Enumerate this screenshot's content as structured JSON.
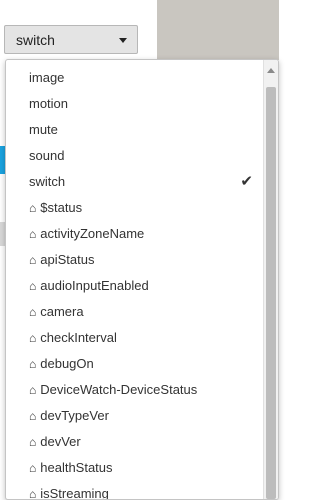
{
  "select": {
    "value": "switch"
  },
  "dropdown": {
    "selected": "switch",
    "options": [
      {
        "label": "image",
        "icon": "",
        "checked": false
      },
      {
        "label": "motion",
        "icon": "",
        "checked": false
      },
      {
        "label": "mute",
        "icon": "",
        "checked": false
      },
      {
        "label": "sound",
        "icon": "",
        "checked": false
      },
      {
        "label": "switch",
        "icon": "",
        "checked": true
      },
      {
        "label": "$status",
        "icon": "⌂",
        "checked": false
      },
      {
        "label": "activityZoneName",
        "icon": "⌂",
        "checked": false
      },
      {
        "label": "apiStatus",
        "icon": "⌂",
        "checked": false
      },
      {
        "label": "audioInputEnabled",
        "icon": "⌂",
        "checked": false
      },
      {
        "label": "camera",
        "icon": "⌂",
        "checked": false
      },
      {
        "label": "checkInterval",
        "icon": "⌂",
        "checked": false
      },
      {
        "label": "debugOn",
        "icon": "⌂",
        "checked": false
      },
      {
        "label": "DeviceWatch-DeviceStatus",
        "icon": "⌂",
        "checked": false
      },
      {
        "label": "devTypeVer",
        "icon": "⌂",
        "checked": false
      },
      {
        "label": "devVer",
        "icon": "⌂",
        "checked": false
      },
      {
        "label": "healthStatus",
        "icon": "⌂",
        "checked": false
      },
      {
        "label": "isStreaming",
        "icon": "⌂",
        "checked": false
      }
    ],
    "check_glyph": "✔"
  }
}
